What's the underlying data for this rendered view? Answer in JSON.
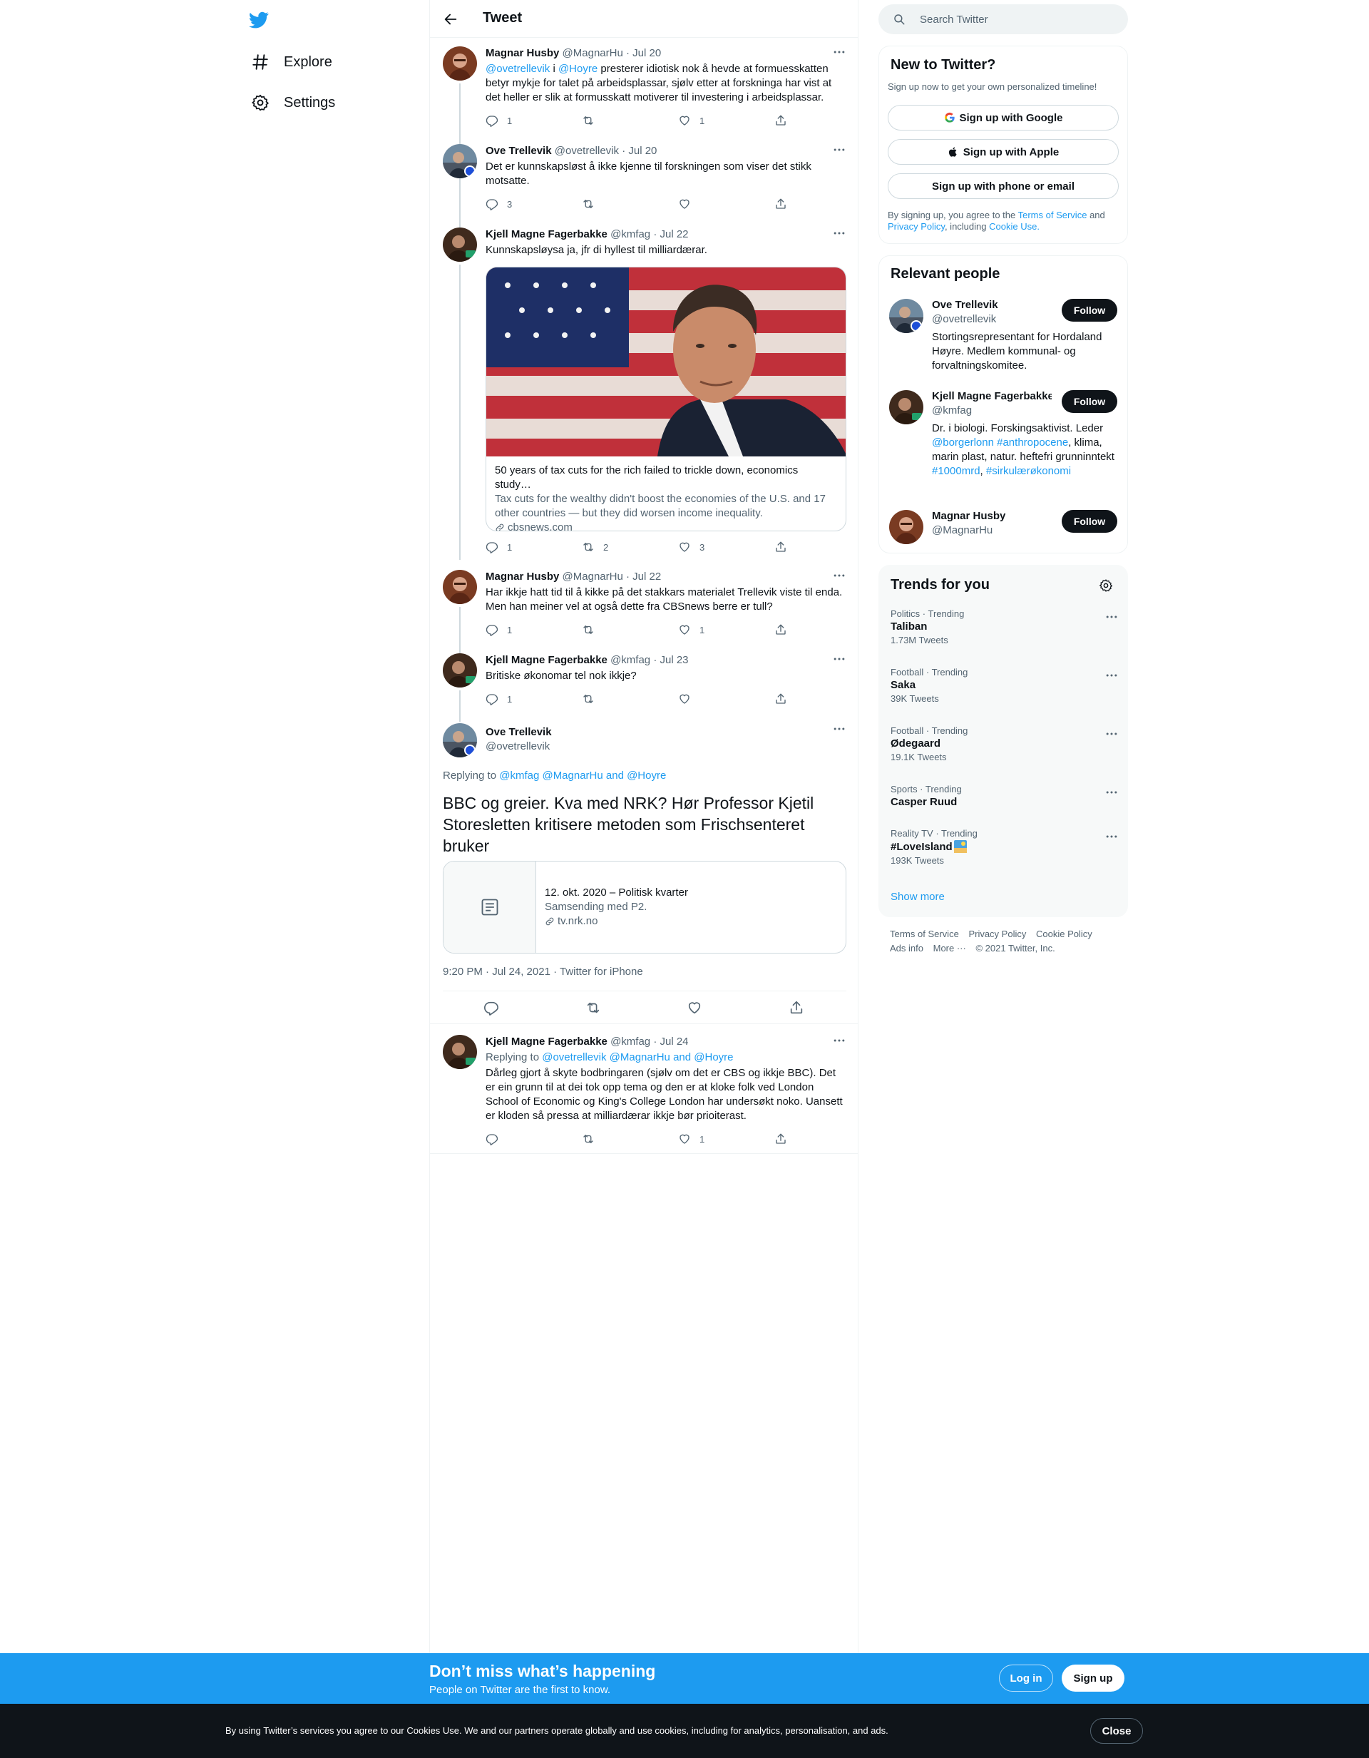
{
  "nav": {
    "explore": "Explore",
    "settings": "Settings"
  },
  "header": {
    "title": "Tweet"
  },
  "tweets": [
    {
      "name": "Magnar Husby",
      "handle": "@MagnarHu",
      "date": "· Jul 20",
      "mention1": "@ovetrellevik",
      "mid": "i",
      "mention2": "@Hoyre",
      "text": "presterer idiotisk nok å hevde at formuesskatten betyr mykje for talet på arbeidsplassar, sjølv etter at forskninga har vist at det heller er slik at formusskatt motiverer til investering i arbeidsplassar.",
      "replies": "1",
      "retweets": "",
      "likes": "1"
    },
    {
      "name": "Ove Trellevik",
      "handle": "@ovetrellevik",
      "date": "· Jul 20",
      "text": "Det er kunnskapsløst å ikke kjenne til forskningen som viser det stikk motsatte.",
      "replies": "3",
      "retweets": "",
      "likes": ""
    },
    {
      "name": "Kjell Magne Fagerbakke",
      "handle": "@kmfag",
      "date": "· Jul 22",
      "text": "Kunnskapsløysa ja, jfr di hyllest til milliardærar.",
      "card": {
        "title": "50 years of tax cuts for the rich failed to trickle down, economics study…",
        "desc": "Tax cuts for the wealthy didn't boost the economies of the U.S. and 17 other countries — but they did worsen income inequality.",
        "domain": "cbsnews.com"
      },
      "replies": "1",
      "retweets": "2",
      "likes": "3"
    },
    {
      "name": "Magnar Husby",
      "handle": "@MagnarHu",
      "date": "· Jul 22",
      "text": "Har ikkje hatt tid til å kikke på det stakkars materialet Trellevik viste til enda. Men han meiner vel at også dette fra CBSnews berre er tull?",
      "replies": "1",
      "retweets": "",
      "likes": "1"
    },
    {
      "name": "Kjell Magne Fagerbakke",
      "handle": "@kmfag",
      "date": "· Jul 23",
      "text": "Britiske økonomar tel nok ikkje?",
      "replies": "1",
      "retweets": "",
      "likes": ""
    }
  ],
  "main_tweet": {
    "name": "Ove Trellevik",
    "handle": "@ovetrellevik",
    "replying_prefix": "Replying to",
    "replying_to": "@kmfag @MagnarHu and @Hoyre",
    "text": "BBC og greier. Kva med NRK? Hør Professor Kjetil Storesletten kritisere metoden som Frischsenteret bruker",
    "card": {
      "title": "12. okt. 2020 – Politisk kvarter",
      "desc": "Samsending med P2.",
      "domain": "tv.nrk.no"
    },
    "meta": "9:20 PM · Jul 24, 2021 · Twitter for iPhone"
  },
  "reply_tweet": {
    "name": "Kjell Magne Fagerbakke",
    "handle": "@kmfag",
    "date": "· Jul 24",
    "replying_prefix": "Replying to",
    "replying_to": "@ovetrellevik @MagnarHu and @Hoyre",
    "text": "Dårleg gjort å skyte bodbringaren (sjølv om det er CBS og ikkje BBC). Det er ein grunn til at dei tok opp tema og den er at kloke folk ved London School of Economic og King's College London har undersøkt noko. Uansett er kloden så pressa at milliardærar ikkje bør prioiterast.",
    "replies": "",
    "retweets": "",
    "likes": "1"
  },
  "search": {
    "placeholder": "Search Twitter"
  },
  "new_to_twitter": {
    "title": "New to Twitter?",
    "subtitle": "Sign up now to get your own personalized timeline!",
    "google": "Sign up with Google",
    "apple": "Sign up with Apple",
    "phone": "Sign up with phone or email",
    "legal_1": "By signing up, you agree to the",
    "tos": "Terms of Service",
    "and": "and",
    "privacy": "Privacy Policy",
    "including": ", including",
    "cookie": "Cookie Use."
  },
  "relevant": {
    "title": "Relevant people",
    "follow": "Follow",
    "people": [
      {
        "name": "Ove Trellevik",
        "handle": "@ovetrellevik",
        "bio": "Stortingsrepresentant for Hordaland Høyre. Medlem kommunal- og forvaltningskomitee."
      },
      {
        "name": "Kjell Magne Fagerbakke",
        "handle": "@kmfag",
        "bio1": "Dr. i biologi. Forskingsaktivist. Leder",
        "bio_link1": "@borgerlonn",
        "bio_link2": "#anthropocene",
        "bio2": ", klima, marin plast, natur. heftefri grunninntekt",
        "bio_link3": "#1000mrd",
        "bio_comma": ",",
        "bio_link4": "#sirkulærøkonomi"
      },
      {
        "name": "Magnar Husby",
        "handle": "@MagnarHu"
      }
    ]
  },
  "trends": {
    "title": "Trends for you",
    "items": [
      {
        "meta": "Politics · Trending",
        "name": "Taliban",
        "count": "1.73M Tweets"
      },
      {
        "meta": "Football · Trending",
        "name": "Saka",
        "count": "39K Tweets"
      },
      {
        "meta": "Football · Trending",
        "name": "Ødegaard",
        "count": "19.1K Tweets"
      },
      {
        "meta": "Sports · Trending",
        "name": "Casper Ruud",
        "count": ""
      },
      {
        "meta": "Reality TV · Trending",
        "name": "#LoveIsland",
        "count": "193K Tweets"
      }
    ],
    "show_more": "Show more"
  },
  "footer": {
    "terms": "Terms of Service",
    "privacy": "Privacy Policy",
    "cookie": "Cookie Policy",
    "ads": "Ads info",
    "more": "More ···",
    "copyright": "© 2021 Twitter, Inc."
  },
  "banner": {
    "title": "Don’t miss what’s happening",
    "subtitle": "People on Twitter are the first to know.",
    "login": "Log in",
    "signup": "Sign up"
  },
  "cookie_bar": {
    "text": "By using Twitter’s services you agree to our Cookies Use. We and our partners operate globally and use cookies, including for analytics, personalisation, and ads.",
    "close": "Close"
  },
  "colors": {
    "accent": "#1d9bf0",
    "text": "#0f1419",
    "muted": "#536471",
    "banner": "#1d9bf0",
    "cookie_bg": "#0f1419"
  }
}
